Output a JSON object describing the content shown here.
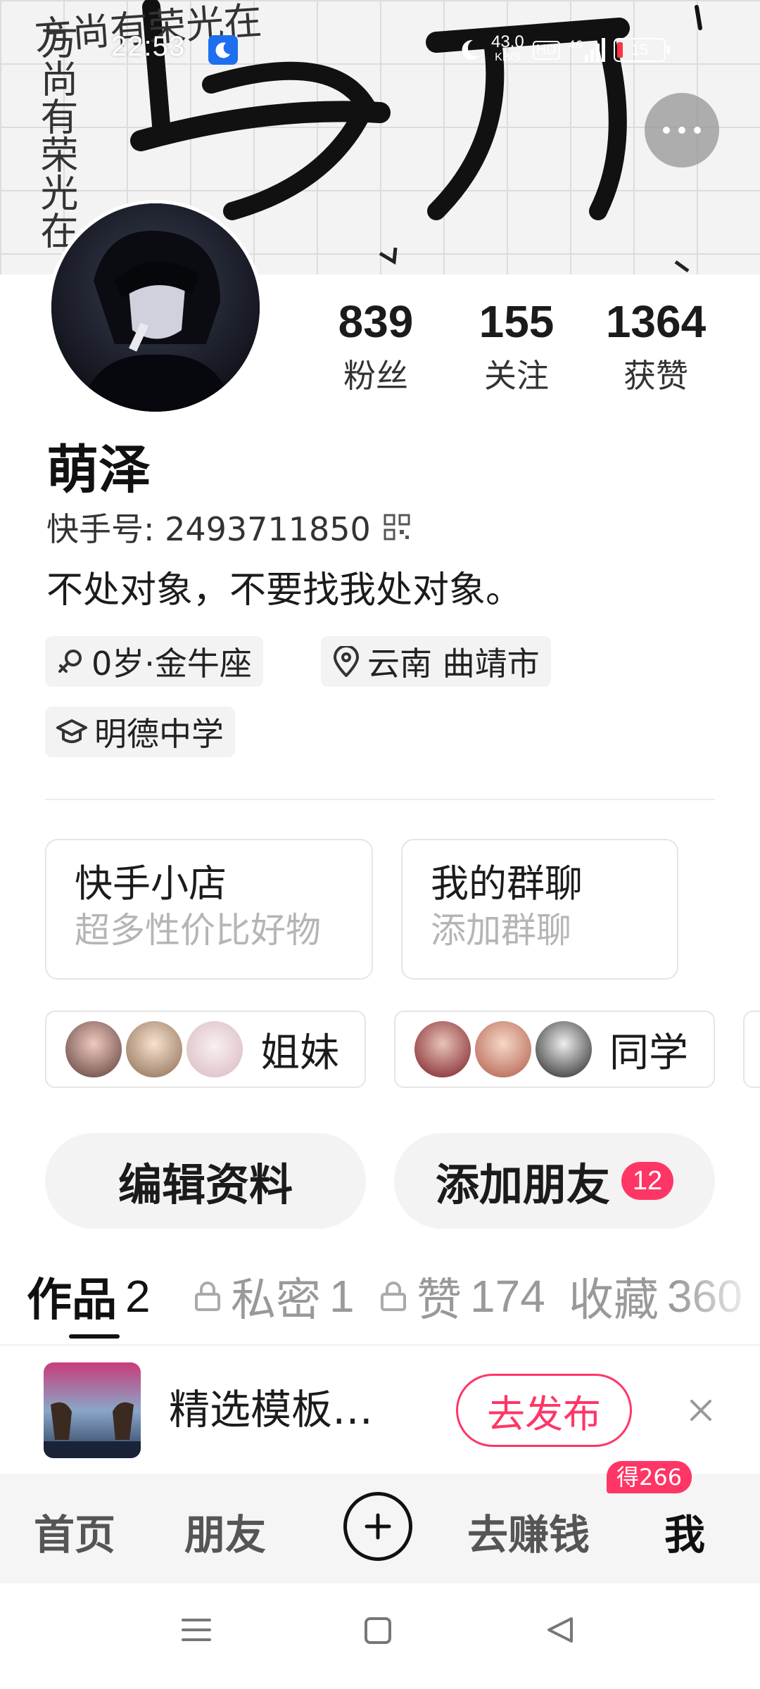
{
  "status_bar": {
    "time": "22:53",
    "net_speed_value": "43.0",
    "net_speed_unit": "KB/S",
    "hd": "HD",
    "network": "46",
    "battery": "15"
  },
  "banner": {
    "big_chars": "学习",
    "side_text": "方尚有荣光在"
  },
  "stats": [
    {
      "value": "839",
      "label": "粉丝"
    },
    {
      "value": "155",
      "label": "关注"
    },
    {
      "value": "1364",
      "label": "获赞"
    }
  ],
  "profile": {
    "nickname": "萌泽",
    "kwai_id": "快手号: 2493711850",
    "bio": "不处对象，不要找我处对象。",
    "tags": {
      "age_sign": "0岁·金牛座",
      "location": "云南 曲靖市",
      "school": "明德中学"
    }
  },
  "cards": [
    {
      "title": "快手小店",
      "subtitle": "超多性价比好物"
    },
    {
      "title": "我的群聊",
      "subtitle": "添加群聊"
    }
  ],
  "groups": [
    {
      "label": "姐妹"
    },
    {
      "label": "同学"
    }
  ],
  "actions": {
    "edit_profile": "编辑资料",
    "add_friends": "添加朋友",
    "add_friends_badge": "12"
  },
  "tabs": [
    {
      "label": "作品",
      "count": "2"
    },
    {
      "label": "私密",
      "count": "1"
    },
    {
      "label": "赞",
      "count": "174"
    },
    {
      "label": "收藏",
      "count": "360"
    }
  ],
  "promo": {
    "text": "精选模板…",
    "button": "去发布"
  },
  "bottom_nav": {
    "home": "首页",
    "friends": "朋友",
    "earn": "去赚钱",
    "earn_badge": "得266",
    "me": "我"
  },
  "colors": {
    "accent": "#fe3666",
    "status_blue": "#1e6ff0"
  }
}
